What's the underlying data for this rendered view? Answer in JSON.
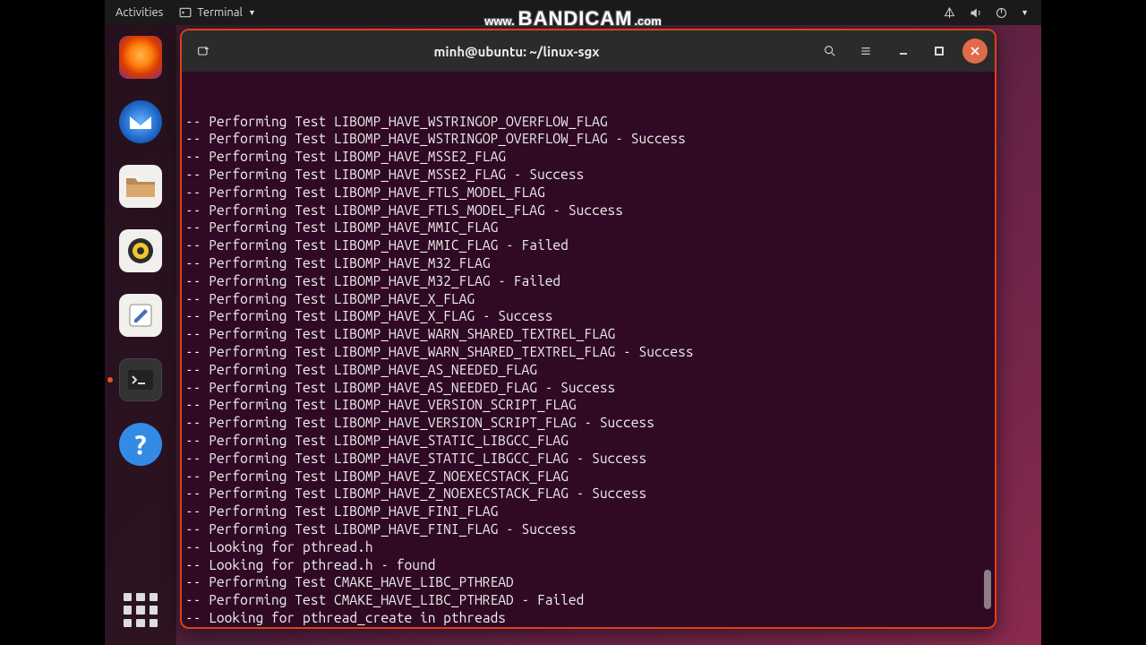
{
  "watermark": {
    "www": "www.",
    "brand": "BANDICAM",
    "com": ".com"
  },
  "topbar": {
    "activities": "Activities",
    "app_name": "Terminal"
  },
  "dock": {
    "items": [
      {
        "name": "firefox"
      },
      {
        "name": "thunderbird"
      },
      {
        "name": "files"
      },
      {
        "name": "rhythmbox"
      },
      {
        "name": "text-editor"
      },
      {
        "name": "terminal",
        "active": true
      },
      {
        "name": "help"
      }
    ]
  },
  "window": {
    "title": "minh@ubuntu: ~/linux-sgx"
  },
  "terminal": {
    "lines": [
      "-- Performing Test LIBOMP_HAVE_WSTRINGOP_OVERFLOW_FLAG",
      "-- Performing Test LIBOMP_HAVE_WSTRINGOP_OVERFLOW_FLAG - Success",
      "-- Performing Test LIBOMP_HAVE_MSSE2_FLAG",
      "-- Performing Test LIBOMP_HAVE_MSSE2_FLAG - Success",
      "-- Performing Test LIBOMP_HAVE_FTLS_MODEL_FLAG",
      "-- Performing Test LIBOMP_HAVE_FTLS_MODEL_FLAG - Success",
      "-- Performing Test LIBOMP_HAVE_MMIC_FLAG",
      "-- Performing Test LIBOMP_HAVE_MMIC_FLAG - Failed",
      "-- Performing Test LIBOMP_HAVE_M32_FLAG",
      "-- Performing Test LIBOMP_HAVE_M32_FLAG - Failed",
      "-- Performing Test LIBOMP_HAVE_X_FLAG",
      "-- Performing Test LIBOMP_HAVE_X_FLAG - Success",
      "-- Performing Test LIBOMP_HAVE_WARN_SHARED_TEXTREL_FLAG",
      "-- Performing Test LIBOMP_HAVE_WARN_SHARED_TEXTREL_FLAG - Success",
      "-- Performing Test LIBOMP_HAVE_AS_NEEDED_FLAG",
      "-- Performing Test LIBOMP_HAVE_AS_NEEDED_FLAG - Success",
      "-- Performing Test LIBOMP_HAVE_VERSION_SCRIPT_FLAG",
      "-- Performing Test LIBOMP_HAVE_VERSION_SCRIPT_FLAG - Success",
      "-- Performing Test LIBOMP_HAVE_STATIC_LIBGCC_FLAG",
      "-- Performing Test LIBOMP_HAVE_STATIC_LIBGCC_FLAG - Success",
      "-- Performing Test LIBOMP_HAVE_Z_NOEXECSTACK_FLAG",
      "-- Performing Test LIBOMP_HAVE_Z_NOEXECSTACK_FLAG - Success",
      "-- Performing Test LIBOMP_HAVE_FINI_FLAG",
      "-- Performing Test LIBOMP_HAVE_FINI_FLAG - Success",
      "-- Looking for pthread.h",
      "-- Looking for pthread.h - found",
      "-- Performing Test CMAKE_HAVE_LIBC_PTHREAD",
      "-- Performing Test CMAKE_HAVE_LIBC_PTHREAD - Failed",
      "-- Looking for pthread_create in pthreads"
    ]
  }
}
